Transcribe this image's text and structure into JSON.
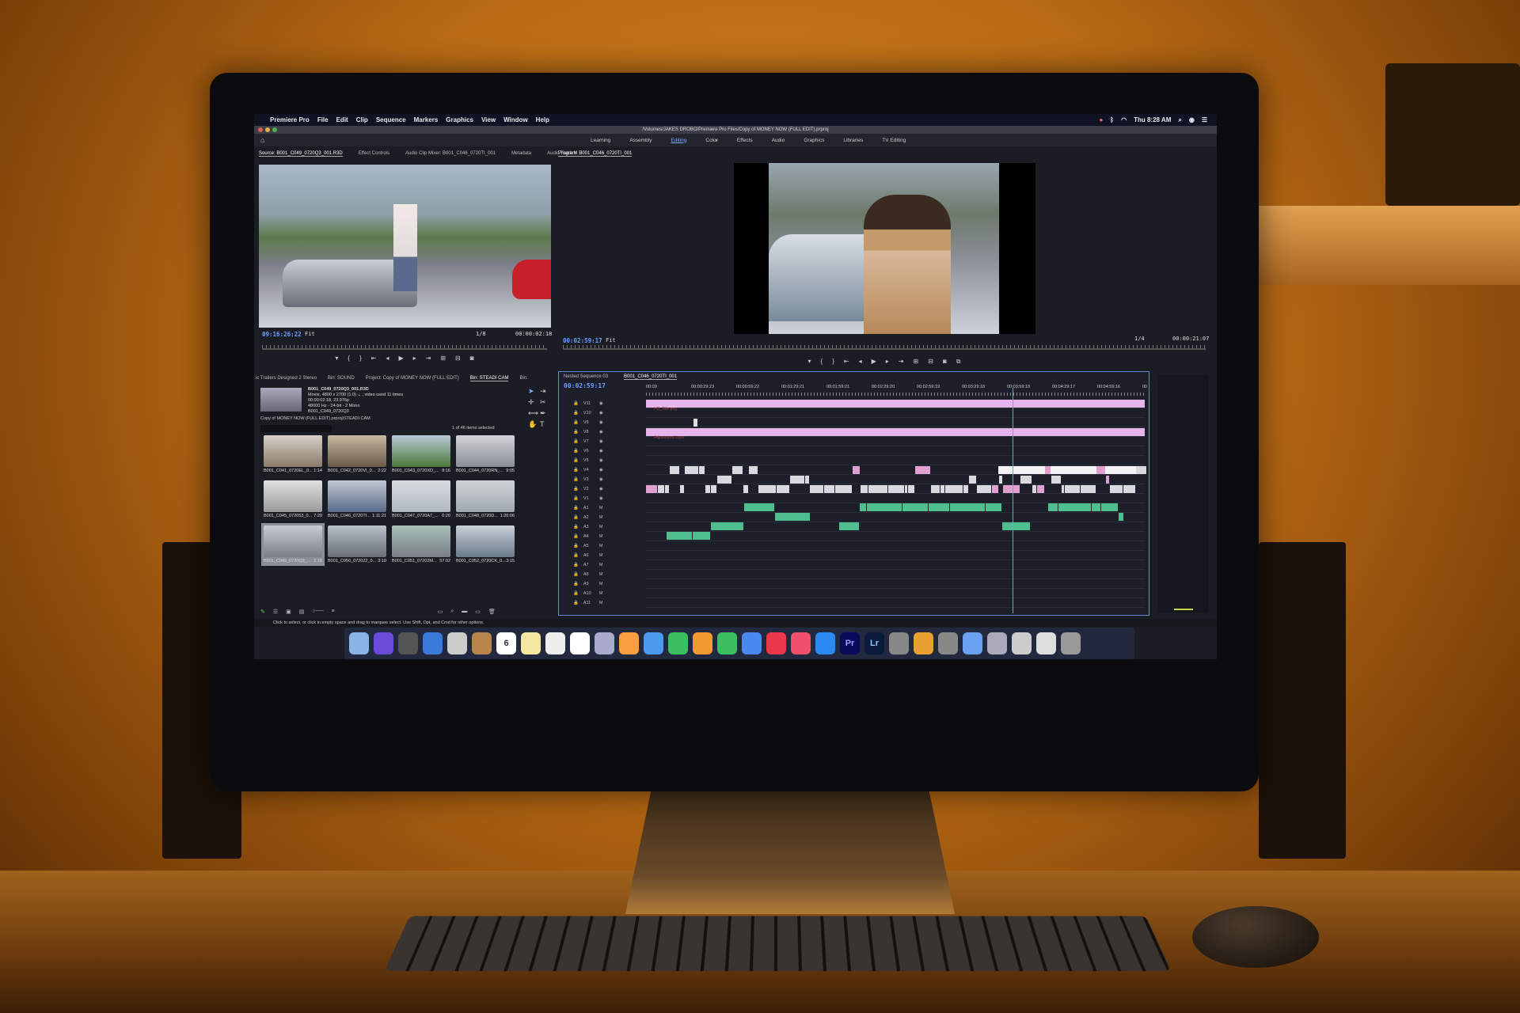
{
  "menubar": {
    "app_name": "Premiere Pro",
    "items": [
      "File",
      "Edit",
      "Clip",
      "Sequence",
      "Markers",
      "Graphics",
      "View",
      "Window",
      "Help"
    ],
    "clock": "Thu 8:28 AM"
  },
  "titlebar": {
    "path": "/Volumes/JAKES DROBO/Premiere Pro Files/Copy of MONEY NOW (FULL EDIT).prproj"
  },
  "workspaces": {
    "tabs": [
      "Learning",
      "Assembly",
      "Editing",
      "Color",
      "Effects",
      "Audio",
      "Graphics",
      "Libraries",
      "TV Editing"
    ],
    "active": "Editing",
    "more": "»"
  },
  "source_panel": {
    "tabs": [
      "Source: B001_C049_0720Q3_001.R3D",
      "Effect Controls",
      "Audio Clip Mixer: B001_C046_0720TI_001",
      "Metadata",
      "Audio Track M"
    ],
    "timecode": "09:16:26:22",
    "zoom": "Fit",
    "resolution": "1/8",
    "duration": "00:00:02:18"
  },
  "program_panel": {
    "tab": "Program: B001_C046_0720TI_001",
    "timecode": "00:02:59:17",
    "zoom": "Fit",
    "resolution": "1/4",
    "duration": "00:00:21:07"
  },
  "project_panel": {
    "tabs": [
      "ic Trailers Designed 2 Stereo",
      "Bin: SOUND",
      "Project: Copy of MONEY NOW (FULL EDIT)",
      "Bin: STEADI CAM",
      "Bin:"
    ],
    "active_tab": "Bin: STEADI CAM",
    "preview": {
      "name": "B001_C049_0720Q3_001.R3D",
      "info1": "Movie, 4800 x 2700 (1.0) ⌄ , video used 11 times",
      "info2": "00:00:02:18, 23.976p",
      "info3": "48000 Hz - 24-bit - 2 Mono",
      "info4": "B001_C049_0720Q3"
    },
    "path": "Copy of MONEY NOW (FULL EDIT).prproj\\STEADI CAM",
    "selection": "1 of 46 items selected",
    "items": [
      {
        "name": "B001_C041_0720EL_0...",
        "duration": "1:14"
      },
      {
        "name": "B001_C042_0720VI_0...",
        "duration": "2:22"
      },
      {
        "name": "B001_C043_0720XD_...",
        "duration": "8:16"
      },
      {
        "name": "B001_C044_0720RN_...",
        "duration": "9:05"
      },
      {
        "name": "B001_C045_072053_0...",
        "duration": "7:20"
      },
      {
        "name": "B001_C046_0720TI...",
        "duration": "1:11:21"
      },
      {
        "name": "B001_C047_0720A7_...",
        "duration": "0:20"
      },
      {
        "name": "B001_C048_0720D...",
        "duration": "1:26:06"
      },
      {
        "name": "B001_C049_0720Q3_...",
        "duration": "2:18"
      },
      {
        "name": "B001_C050_072022_0...",
        "duration": "3:10"
      },
      {
        "name": "B001_C051_07202M...",
        "duration": "57:02"
      },
      {
        "name": "B001_C052_0720CK_0...",
        "duration": "3:15"
      }
    ]
  },
  "timeline": {
    "tabs": [
      "Nested Sequence 03",
      "B001_C046_0720TI_001"
    ],
    "timecode": "00:02:59:17",
    "ruler": [
      "00:00",
      "00:00:29:23",
      "00:00:59:22",
      "00:01:29:21",
      "00:01:59:21",
      "00:02:29:20",
      "00:02:59:19",
      "00:03:29:18",
      "00:03:59:18",
      "00:04:29:17",
      "00:04:59:16",
      "00"
    ],
    "video_tracks": [
      "V11",
      "V10",
      "V9",
      "V8",
      "V7",
      "V6",
      "V5",
      "V4",
      "V3",
      "V2",
      "V1"
    ],
    "audio_tracks": [
      "A1",
      "A2",
      "A3",
      "A4",
      "A5",
      "A6",
      "A7",
      "A8",
      "A9",
      "A10",
      "A11"
    ],
    "clip_title": "HD_Title.png",
    "clip_adjustment": "Adjustment Layer"
  },
  "status_bar": "Click to select, or click in empty space and drag to marquee select. Use Shift, Opt, and Cmd for other options.",
  "dock": [
    "finder",
    "siri",
    "launchpad",
    "safari",
    "mail-stamp",
    "contacts",
    "calendar",
    "notes",
    "textedit",
    "reminders",
    "preview",
    "photos",
    "messages",
    "facetime",
    "pages",
    "numbers",
    "keynote",
    "news",
    "music",
    "app-store",
    "premiere-pro",
    "lightroom",
    "system-preferences",
    "folder",
    "quicktime",
    "media-player",
    "screen-share",
    "document",
    "document-list",
    "trash"
  ],
  "dock_labels": {
    "calendar": "6",
    "premiere-pro": "Pr",
    "lightroom": "Lr"
  },
  "colors": {
    "accent": "#6fa0ff",
    "clip_pink": "#e7b4ec",
    "clip_green": "#4fbf90",
    "clip_audio": "#3aa57a"
  }
}
